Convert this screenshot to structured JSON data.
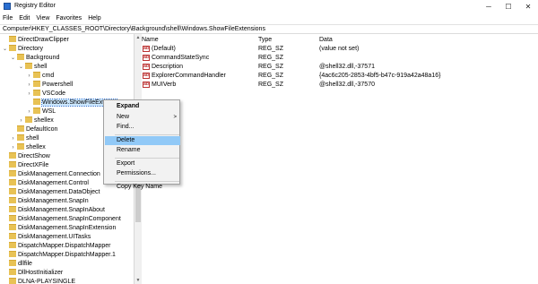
{
  "window": {
    "title": "Registry Editor",
    "min": "─",
    "max": "☐",
    "close": "✕"
  },
  "menu": [
    "File",
    "Edit",
    "View",
    "Favorites",
    "Help"
  ],
  "address": "Computer\\HKEY_CLASSES_ROOT\\Directory\\Background\\shell\\Windows.ShowFileExtensions",
  "tree": [
    {
      "label": "DirectDrawClipper",
      "chev": "",
      "indent": 0
    },
    {
      "label": "Directory",
      "chev": "v",
      "indent": 0
    },
    {
      "label": "Background",
      "chev": "v",
      "indent": 1
    },
    {
      "label": "shell",
      "chev": "v",
      "indent": 2
    },
    {
      "label": "cmd",
      "chev": ">",
      "indent": 3
    },
    {
      "label": "Powershell",
      "chev": ">",
      "indent": 3
    },
    {
      "label": "VSCode",
      "chev": ">",
      "indent": 3
    },
    {
      "label": "Windows.ShowFileExtens",
      "chev": "",
      "indent": 3,
      "selected": true
    },
    {
      "label": "WSL",
      "chev": ">",
      "indent": 3
    },
    {
      "label": "shellex",
      "chev": ">",
      "indent": 2
    },
    {
      "label": "DefaultIcon",
      "chev": "",
      "indent": 1
    },
    {
      "label": "shell",
      "chev": ">",
      "indent": 1
    },
    {
      "label": "shellex",
      "chev": ">",
      "indent": 1
    },
    {
      "label": "DirectShow",
      "chev": "",
      "indent": 0
    },
    {
      "label": "DirectXFile",
      "chev": "",
      "indent": 0
    },
    {
      "label": "DiskManagement.Connection",
      "chev": "",
      "indent": 0
    },
    {
      "label": "DiskManagement.Control",
      "chev": "",
      "indent": 0
    },
    {
      "label": "DiskManagement.DataObject",
      "chev": "",
      "indent": 0
    },
    {
      "label": "DiskManagement.SnapIn",
      "chev": "",
      "indent": 0
    },
    {
      "label": "DiskManagement.SnapInAbout",
      "chev": "",
      "indent": 0
    },
    {
      "label": "DiskManagement.SnapInComponent",
      "chev": "",
      "indent": 0
    },
    {
      "label": "DiskManagement.SnapInExtension",
      "chev": "",
      "indent": 0
    },
    {
      "label": "DiskManagement.UITasks",
      "chev": "",
      "indent": 0
    },
    {
      "label": "DispatchMapper.DispatchMapper",
      "chev": "",
      "indent": 0
    },
    {
      "label": "DispatchMapper.DispatchMapper.1",
      "chev": "",
      "indent": 0
    },
    {
      "label": "dllfile",
      "chev": "",
      "indent": 0
    },
    {
      "label": "DllHostInitializer",
      "chev": "",
      "indent": 0
    },
    {
      "label": "DLNA-PLAYSINGLE",
      "chev": "",
      "indent": 0
    }
  ],
  "columns": {
    "name": "Name",
    "type": "Type",
    "data": "Data"
  },
  "values": [
    {
      "name": "(Default)",
      "type": "REG_SZ",
      "data": "(value not set)"
    },
    {
      "name": "CommandStateSync",
      "type": "REG_SZ",
      "data": ""
    },
    {
      "name": "Description",
      "type": "REG_SZ",
      "data": "@shell32.dll,-37571"
    },
    {
      "name": "ExplorerCommandHandler",
      "type": "REG_SZ",
      "data": "{4ac6c205-2853-4bf5-b47c-919a42a48a16}"
    },
    {
      "name": "MUIVerb",
      "type": "REG_SZ",
      "data": "@shell32.dll,-37570"
    }
  ],
  "context_menu": [
    {
      "label": "Expand",
      "bold": true
    },
    {
      "label": "New",
      "submenu": ">"
    },
    {
      "label": "Find..."
    },
    {
      "sep": true
    },
    {
      "label": "Delete",
      "highlighted": true
    },
    {
      "label": "Rename"
    },
    {
      "sep": true
    },
    {
      "label": "Export"
    },
    {
      "label": "Permissions..."
    },
    {
      "sep": true
    },
    {
      "label": "Copy Key Name"
    }
  ],
  "icons": {
    "value_icon": "ab",
    "folder": "folder-icon"
  }
}
